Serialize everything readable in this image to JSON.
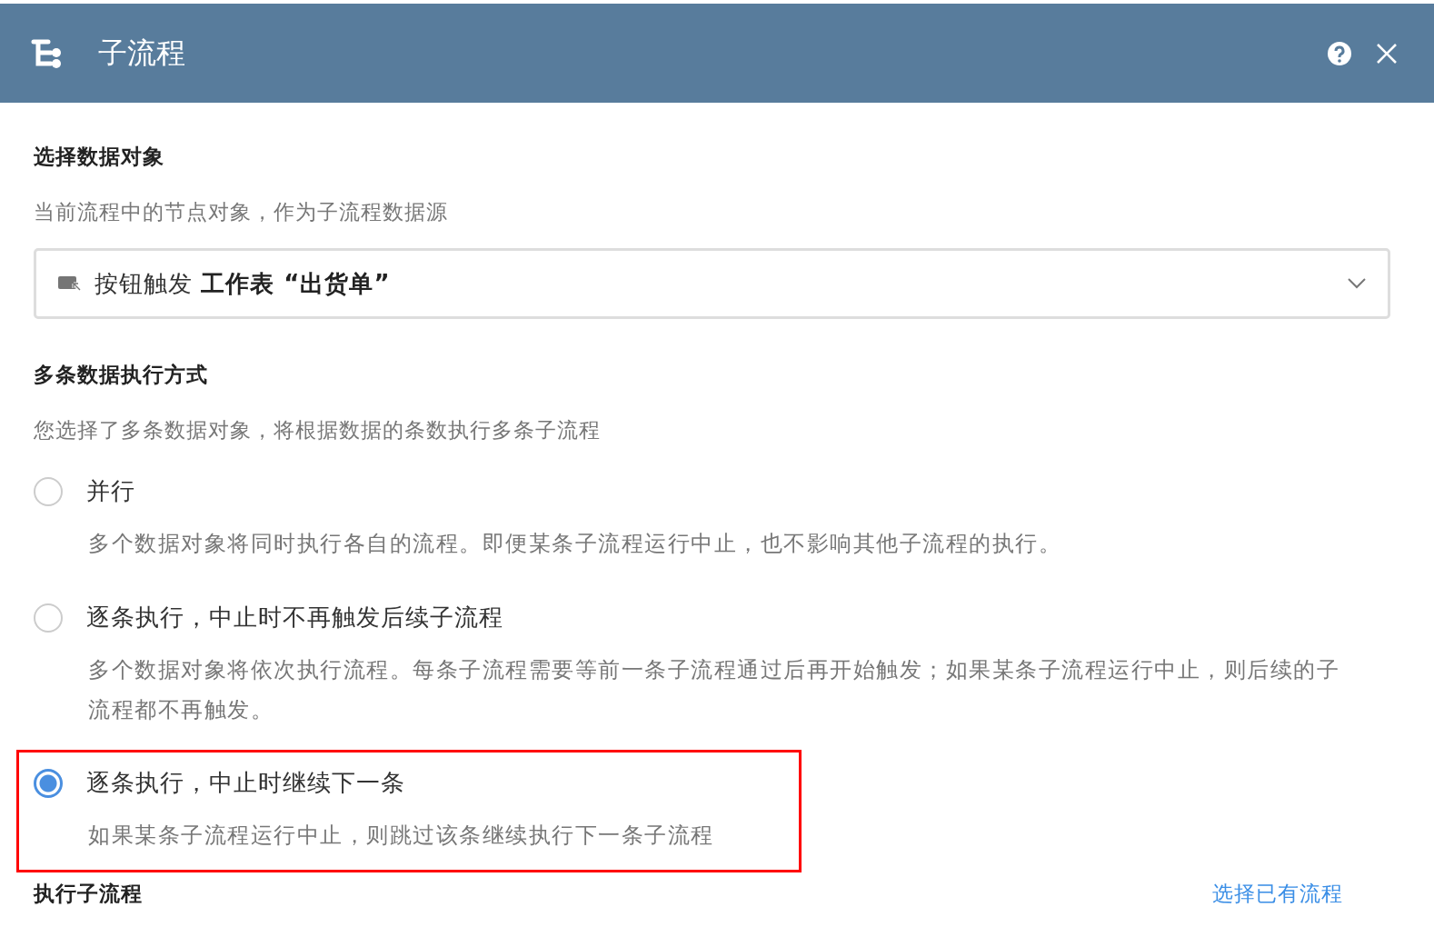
{
  "window": {
    "title": "子流程"
  },
  "data_object": {
    "heading": "选择数据对象",
    "hint": "当前流程中的节点对象，作为子流程数据源",
    "select": {
      "value": "按钮触发 **工作表 “出货单”**"
    }
  },
  "execution_mode": {
    "heading": "多条数据执行方式",
    "hint": "您选择了多条数据对象，将根据数据的条数执行多条子流程",
    "options": [
      {
        "label": "并行",
        "description": "多个数据对象将同时执行各自的流程。即便某条子流程运行中止，也不影响其他子流程的执行。",
        "selected": false,
        "highlighted": false
      },
      {
        "label": "逐条执行，中止时不再触发后续子流程",
        "description": "多个数据对象将依次执行流程。每条子流程需要等前一条子流程通过后再开始触发；如果某条子流程运行中止，则后续的子流程都不再触发。",
        "selected": false,
        "highlighted": false
      },
      {
        "label": "逐条执行，中止时继续下一条",
        "description": "如果某条子流程运行中止，则跳过该条继续执行下一条子流程",
        "selected": true,
        "highlighted": true
      }
    ]
  },
  "footer": {
    "heading": "执行子流程",
    "link": "选择已有流程"
  }
}
